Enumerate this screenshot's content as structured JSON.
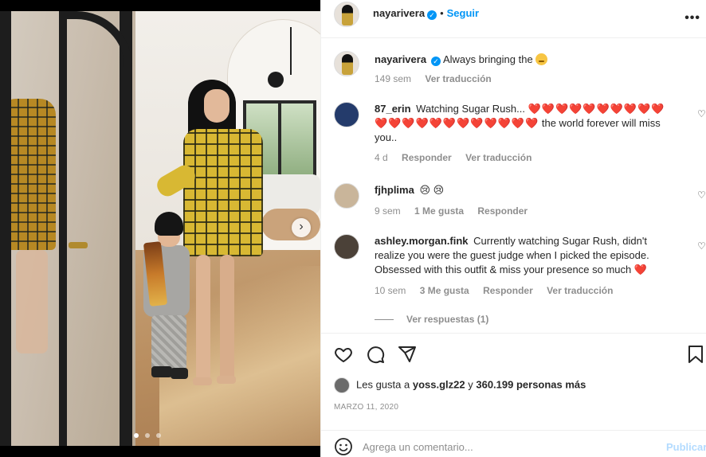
{
  "post": {
    "author": "nayarivera",
    "follow_label": "Seguir",
    "separator": "•",
    "more_label": "•••",
    "carousel": {
      "dots": 3,
      "active": 0,
      "next_label": "›"
    }
  },
  "caption": {
    "username": "nayarivera",
    "text": "Always bringing the",
    "emoji": "smiling-face-emoji",
    "time": "149 sem",
    "translate": "Ver traducción"
  },
  "comments": [
    {
      "username": "87_erin",
      "text_before": "Watching Sugar Rush...",
      "hearts": "❤️❤️❤️❤️❤️❤️❤️❤️❤️❤️❤️❤️❤️❤️❤️❤️❤️❤️❤️❤️❤️❤️",
      "text_after": "the world forever will miss you..",
      "time": "4 d",
      "reply": "Responder",
      "translate": "Ver traducción"
    },
    {
      "username": "fjhplima",
      "emojis": "😢 😢",
      "time": "9 sem",
      "likes": "1 Me gusta",
      "reply": "Responder"
    },
    {
      "username": "ashley.morgan.fink",
      "text": "Currently watching Sugar Rush, didn't realize you were the guest judge when I picked the episode. Obsessed with this outfit & miss your presence so much",
      "hearts": "❤️",
      "time": "10 sem",
      "likes": "3 Me gusta",
      "reply": "Responder",
      "translate": "Ver traducción",
      "view_replies": "Ver respuestas (1)"
    }
  ],
  "likes_line": {
    "prefix": "Les gusta a",
    "user": "yoss.glz22",
    "joiner": "y",
    "others": "360.199 personas más"
  },
  "date": "MARZO 11, 2020",
  "composer": {
    "placeholder": "Agrega un comentario...",
    "publish": "Publicar"
  },
  "colors": {
    "accent": "#0095f6",
    "text": "#262626",
    "secondary": "#8e8e8e",
    "publish_disabled": "#b3dbff",
    "heart": "#ed1c24"
  }
}
